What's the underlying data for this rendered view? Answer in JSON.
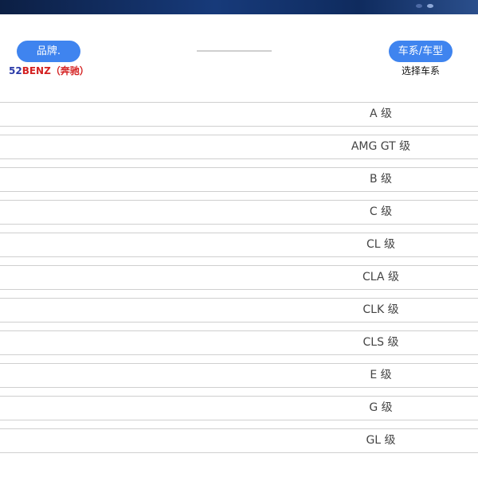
{
  "steps": {
    "brand_label": "品牌.",
    "series_label": "车系/车型"
  },
  "selection": {
    "brand_code": "52",
    "brand_name": "BENZ（奔驰）",
    "series_hint": "选择车系"
  },
  "colors": {
    "step_button": "#3f84ef",
    "brand_text": "#d42121",
    "brand_code": "#2a3aa8",
    "topbar": "#173a7a"
  },
  "series_list": [
    "A 级",
    "AMG GT 级",
    "B 级",
    "C 级",
    "CL 级",
    "CLA 级",
    "CLK 级",
    "CLS 级",
    "E 级",
    "G 级",
    "GL 级"
  ]
}
